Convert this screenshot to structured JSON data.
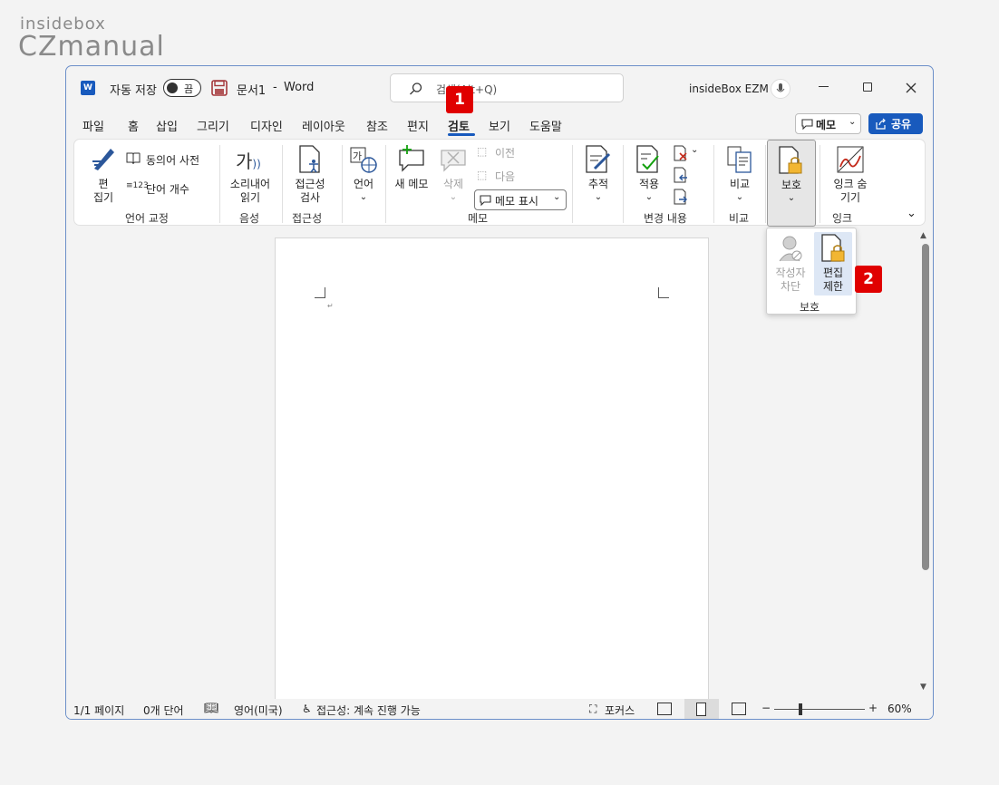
{
  "watermark": {
    "line1": "insidebox",
    "line2": "CZmanual"
  },
  "titlebar": {
    "autosave_label": "자동 저장",
    "autosave_state": "끔",
    "doc_title": "문서1",
    "separator": "-",
    "app_name": "Word",
    "search_placeholder": "검색(Alt+Q)",
    "user_name": "insideBox EZM"
  },
  "menu_tabs": [
    "파일",
    "홈",
    "삽입",
    "그리기",
    "디자인",
    "레이아웃",
    "참조",
    "편지",
    "검토",
    "보기",
    "도움말"
  ],
  "active_tab": "검토",
  "right_buttons": {
    "memo_label": "메모",
    "share_label": "공유"
  },
  "ribbon": {
    "proofing": {
      "spell_label": "편\n집기",
      "thesaurus_label": "동의어 사전",
      "wordcount_label": "단어 개수",
      "group_label": "언어 교정"
    },
    "speech": {
      "read_aloud_label": "소리내어\n읽기",
      "group_label": "음성"
    },
    "accessibility": {
      "check_label": "접근성\n검사",
      "group_label": "접근성"
    },
    "language": {
      "language_label": "언어",
      "group_label": ""
    },
    "comments": {
      "new_label": "새 메모",
      "delete_label": "삭제",
      "prev_label": "이전",
      "next_label": "다음",
      "show_label": "메모 표시",
      "group_label": "메모"
    },
    "tracking": {
      "track_label": "추적",
      "group_label": ""
    },
    "changes": {
      "accept_label": "적용",
      "group_label": "변경 내용"
    },
    "compare": {
      "compare_label": "비교",
      "group_label": "비교"
    },
    "protect": {
      "protect_label": "보호",
      "group_label": ""
    },
    "ink": {
      "hide_ink_label": "잉크 숨\n기기",
      "group_label": "잉크"
    }
  },
  "protect_popup": {
    "block_authors_label": "작성자\n차단",
    "restrict_editing_label": "편집\n제한",
    "group_label": "보호"
  },
  "badges": {
    "one": "1",
    "two": "2"
  },
  "statusbar": {
    "page": "1/1 페이지",
    "words": "0개 단어",
    "language": "영어(미국)",
    "accessibility": "접근성: 계속 진행 가능",
    "focus": "포커스",
    "zoom_minus": "−",
    "zoom_plus": "+",
    "zoom_level": "60%"
  },
  "colors": {
    "accent": "#185abd",
    "badge": "#e00000",
    "save_icon": "#a4373a",
    "window_border": "#6b8fc9"
  }
}
